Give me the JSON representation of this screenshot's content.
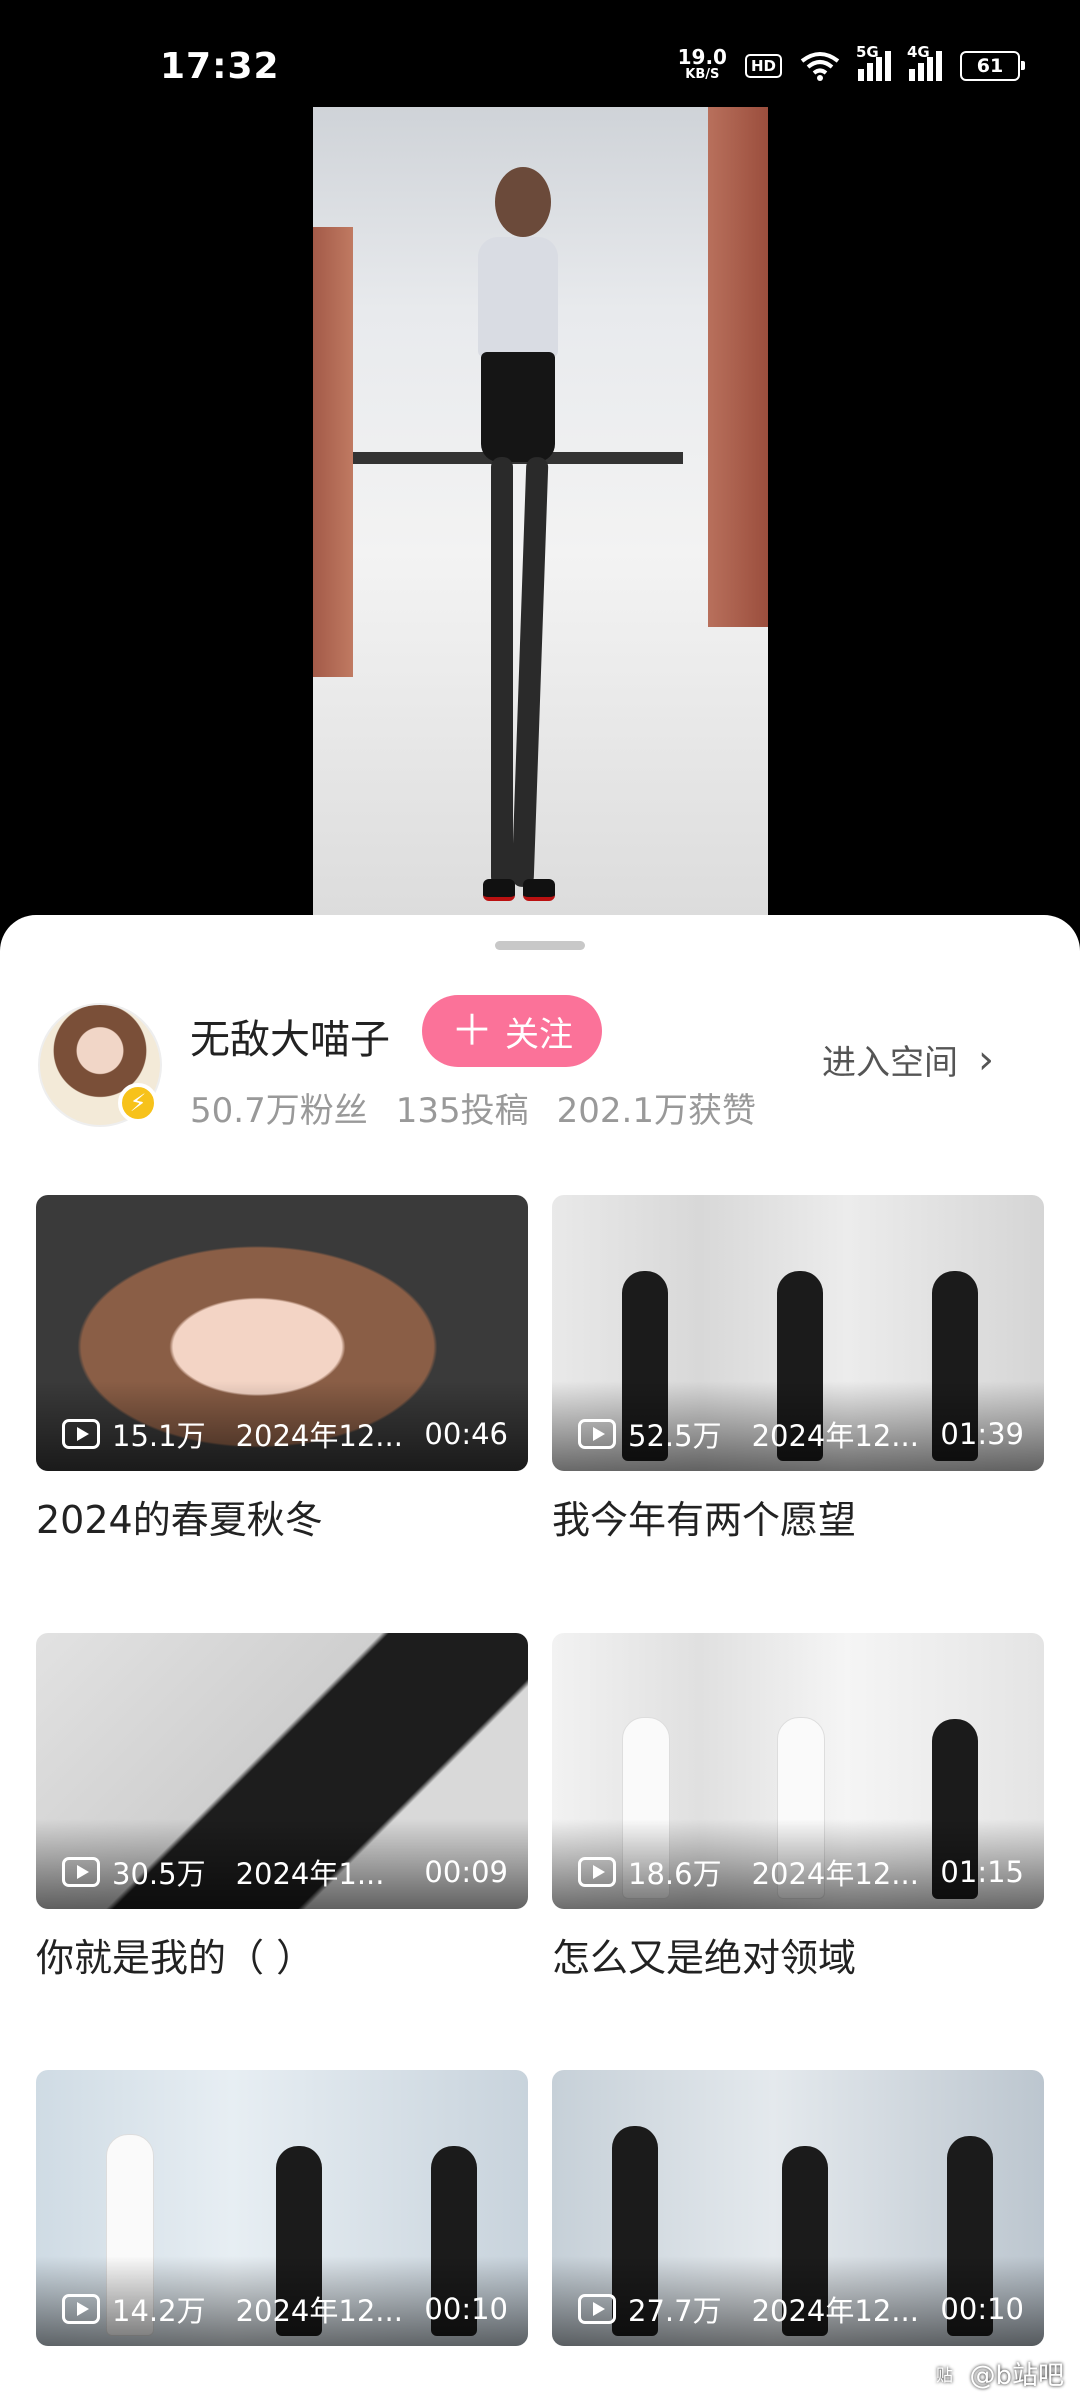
{
  "status_bar": {
    "time": "17:32",
    "net_speed_value": "19.0",
    "net_speed_unit": "KB/S",
    "hd_label": "HD",
    "sim1_label": "5G",
    "sim2_label": "4G",
    "battery": "61"
  },
  "uploader": {
    "name": "无敌大喵子",
    "follow_label": "关注",
    "fans": "50.7万粉丝",
    "posts": "135投稿",
    "likes": "202.1万获赞",
    "enter_space": "进入空间"
  },
  "videos": [
    {
      "views": "15.1万",
      "date": "2024年12...",
      "duration": "00:46",
      "title": "2024的春夏秋冬"
    },
    {
      "views": "52.5万",
      "date": "2024年12...",
      "duration": "01:39",
      "title": "我今年有两个愿望"
    },
    {
      "views": "30.5万",
      "date": "2024年1...",
      "duration": "00:09",
      "title": "你就是我的（      ）"
    },
    {
      "views": "18.6万",
      "date": "2024年12...",
      "duration": "01:15",
      "title": "怎么又是绝对领域"
    },
    {
      "views": "14.2万",
      "date": "2024年12...",
      "duration": "00:10",
      "title": ""
    },
    {
      "views": "27.7万",
      "date": "2024年12...",
      "duration": "00:10",
      "title": ""
    }
  ],
  "watermark": {
    "icon_label": "贴",
    "text": "@b站吧"
  },
  "colors": {
    "accent": "#fb7299",
    "badge": "#f7c21a"
  }
}
